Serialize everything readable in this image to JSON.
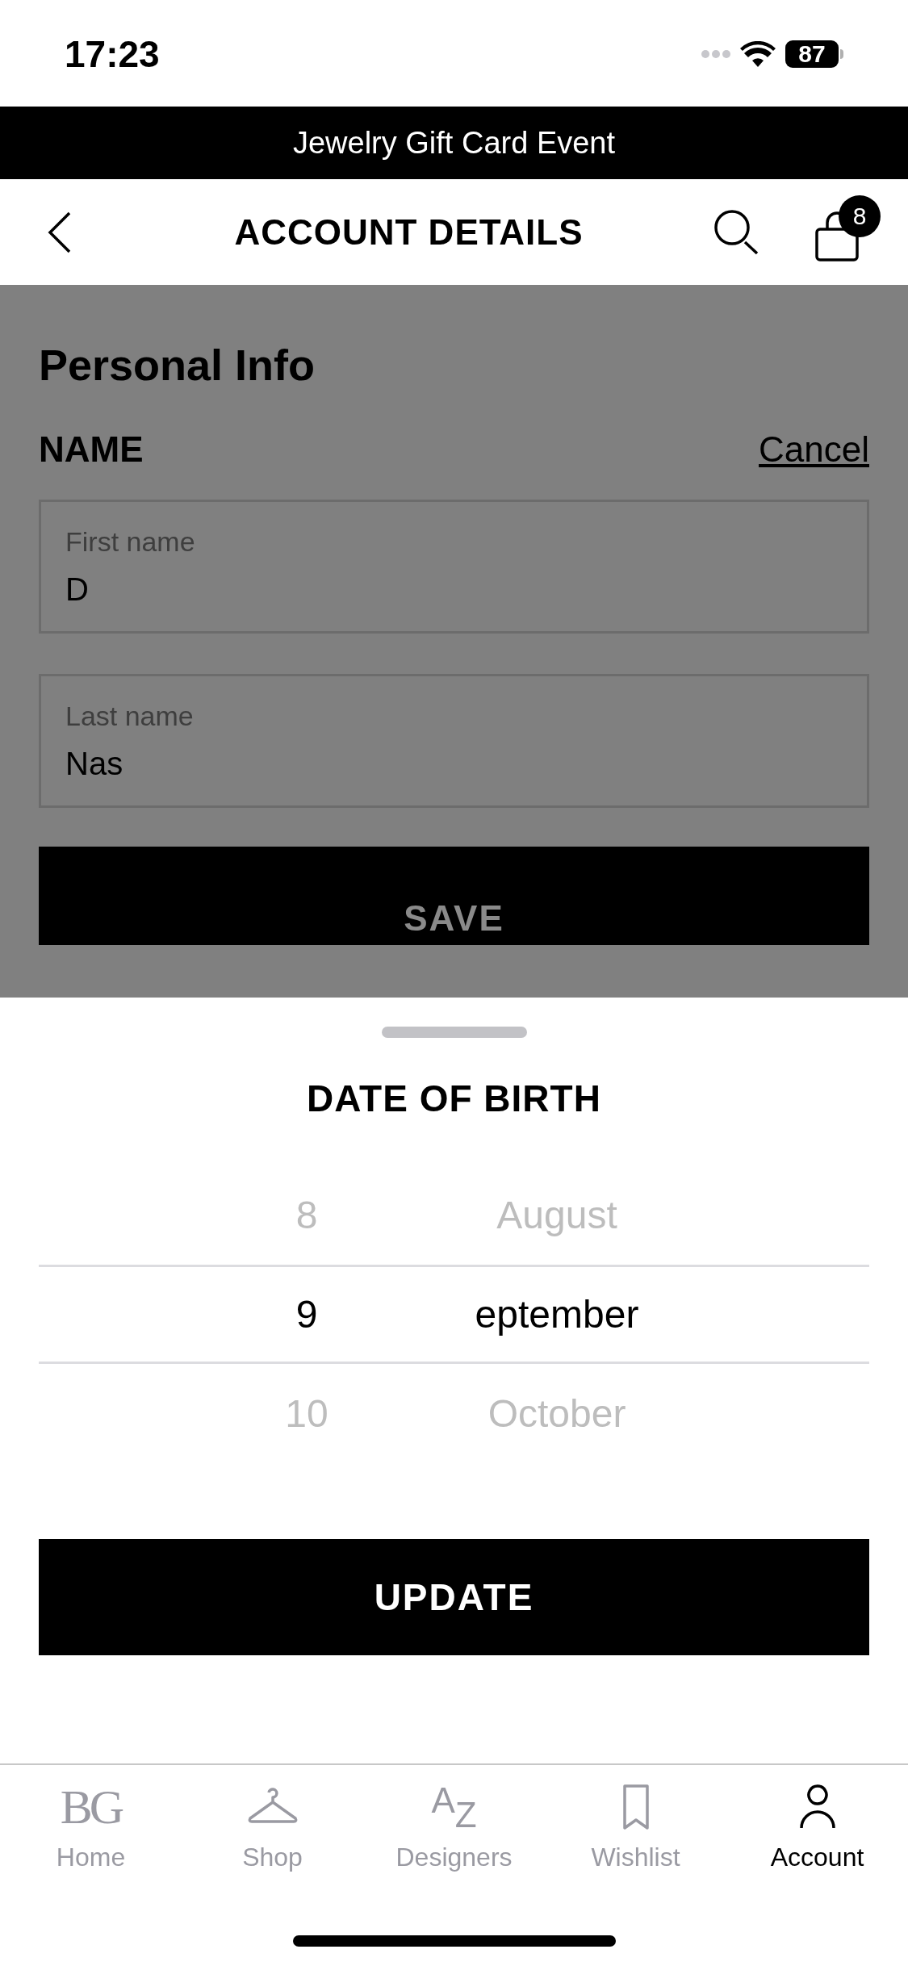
{
  "status_bar": {
    "time": "17:23",
    "battery": "87"
  },
  "promo_banner": {
    "text": "Jewelry Gift Card Event"
  },
  "header": {
    "title": "ACCOUNT DETAILS",
    "cart_count": "8"
  },
  "personal_info": {
    "title": "Personal Info",
    "group_label": "NAME",
    "cancel_link": "Cancel",
    "fields": [
      {
        "label": "First name",
        "value": "D"
      },
      {
        "label": "Last name",
        "value": "Nas"
      }
    ],
    "save_button": "SAVE"
  },
  "date_sheet": {
    "title": "DATE OF BIRTH",
    "rows": [
      {
        "day": "8",
        "month": "August",
        "selected": false
      },
      {
        "day": "9",
        "month": "eptember",
        "selected": true
      },
      {
        "day": "10",
        "month": "October",
        "selected": false
      }
    ],
    "update_button": "UPDATE"
  },
  "tab_bar": [
    {
      "label": "Home",
      "kind": "logo",
      "glyph": "BG",
      "selected": false
    },
    {
      "label": "Shop",
      "kind": "hanger",
      "selected": false
    },
    {
      "label": "Designers",
      "kind": "letters",
      "glyph": "AZ",
      "selected": false
    },
    {
      "label": "Wishlist",
      "kind": "bookmark",
      "selected": false
    },
    {
      "label": "Account",
      "kind": "person",
      "selected": true
    }
  ]
}
